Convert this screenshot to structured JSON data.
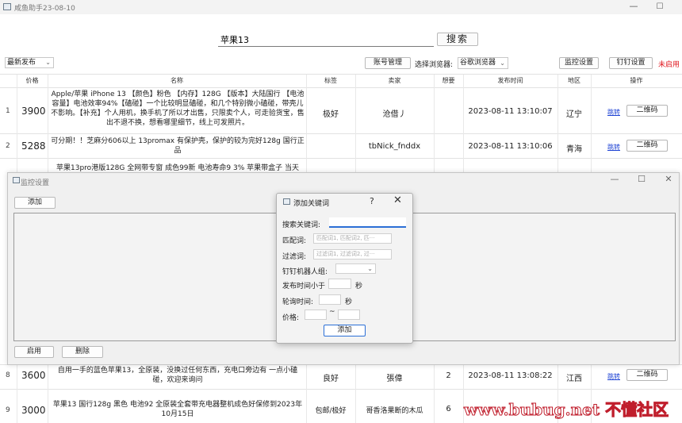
{
  "window": {
    "title": "咸鱼助手23-08-10",
    "min": "—",
    "max": "☐"
  },
  "search": {
    "value": "苹果13",
    "button": "搜索"
  },
  "toolbar": {
    "sort": "最新发布",
    "account_button": "账号管理",
    "browser_label": "选择浏览器:",
    "browser_value": "谷歌浏览器",
    "monitor_button": "监控设置",
    "dingding_button": "钉钉设置",
    "dingding_status": "未启用"
  },
  "table": {
    "headers": [
      "价格",
      "名称",
      "标签",
      "卖家",
      "想要",
      "发布时间",
      "地区",
      "操作"
    ],
    "rows": [
      {
        "num": "1",
        "price": "3900",
        "title": "Apple/苹果 iPhone 13 【颜色】粉色 【内存】128G 【版本】大陆国行 【电池容量】电池效率94%【磕碰】一个比较明显磕碰，和几个特别微小磕碰，带壳儿不影响。【补充】个人用机，换手机了所以才出售，只限卖个人，可走验货宝，售出不退不换，想看哪里细节，线上可发照片。",
        "tag": "极好",
        "seller": "沧借丿",
        "want": "",
        "time": "2023-08-11 13:10:07",
        "region": "辽宁",
        "link": "跳转",
        "qr": "二维码"
      },
      {
        "num": "2",
        "price": "5288",
        "title": "可分期！！芝麻分606以上 13promax 有保护壳，保护的较为完好128g 国行正品",
        "tag": "",
        "seller": "tbNick_fnddx",
        "want": "",
        "time": "2023-08-11 13:10:06",
        "region": "青海",
        "link": "跳转",
        "qr": "二维码"
      },
      {
        "num": "",
        "price": "",
        "title": "苹果13pro港版128G 全网带专窗 成色99新 电池寿命9 3% 苹果带盒子 当天",
        "tag": "",
        "seller": "",
        "want": "",
        "time": "",
        "region": "",
        "link": "",
        "qr": ""
      },
      {
        "num": "8",
        "price": "3600",
        "title": "自用一手的蓝色苹果13，全原装，没换过任何东西，充电口旁边有 一点小磕碰，欢迎来询问",
        "tag": "良好",
        "seller": "張偉",
        "want": "2",
        "time": "2023-08-11 13:08:22",
        "region": "江西",
        "link": "跳转",
        "qr": "二维码"
      },
      {
        "num": "9",
        "price": "3000",
        "title": "苹果13  国行128g 黑色 电池92 全原装全套带充电器整机成色好保修到2023年10月15日",
        "tag": "包邮/极好",
        "seller": "哥香洛果断的木瓜",
        "want": "6",
        "time": "2023-08-11 13:0",
        "region": "",
        "link": "",
        "qr": ""
      }
    ]
  },
  "monitor_dialog": {
    "title": "监控设置",
    "add_button": "添加",
    "enable_button": "启用",
    "delete_button": "删除"
  },
  "keyword_dialog": {
    "title": "添加关键词",
    "help": "?",
    "close": "✕",
    "keyword_label": "搜索关键词:",
    "match_label": "匹配词:",
    "match_placeholder": "匹配词1, 匹配词2, 匹···",
    "filter_label": "过滤词:",
    "filter_placeholder": "过滤词1, 过滤词2, 过···",
    "robot_label": "钉钉机器人组:",
    "publish_label": "发布时间小于",
    "seconds_1": "秒",
    "poll_label": "轮询时间:",
    "seconds_2": "秒",
    "price_label": "价格:",
    "price_sep": "~",
    "add_button": "添加"
  },
  "watermark": {
    "text": "www.bubug.net",
    "cn": "不懂社区"
  }
}
